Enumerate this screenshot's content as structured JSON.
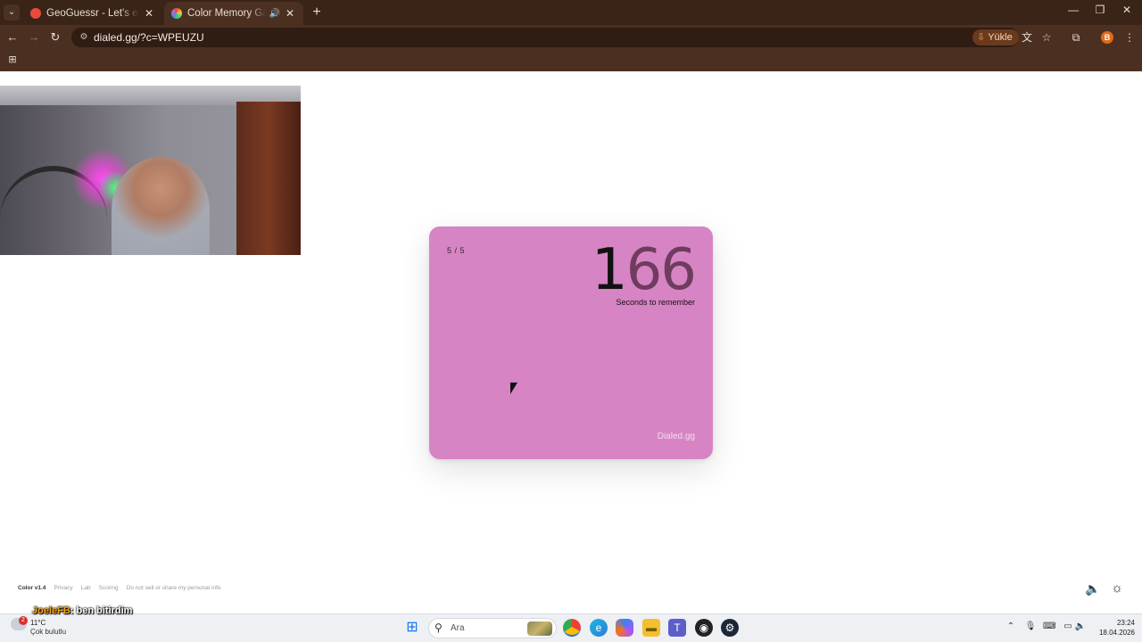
{
  "browser": {
    "tabs": [
      {
        "title": "GeoGuessr - Let's explore the world!",
        "active": false,
        "favicon_color": "#e84b3c"
      },
      {
        "title": "Color Memory Game — How good are you with colors?",
        "active": true,
        "favicon_color": "#a66ad9"
      }
    ],
    "tab_menu_icon": "chevron-down",
    "new_tab_icon": "+",
    "window_controls": [
      "minimize",
      "restore",
      "close"
    ],
    "url": "dialed.gg/?c=WPEUZU",
    "install_label": "Yükle",
    "profile_initial": "B",
    "colors": {
      "frame": "#3a2418",
      "toolbar": "#4b3022",
      "omnibox": "#2f1c12"
    }
  },
  "game": {
    "round": "5 / 5",
    "timer_first_digit": "1",
    "timer_rest_digits": "66",
    "caption": "Seconds to remember",
    "brand": "Dialed.gg",
    "card_color": "#d684c3"
  },
  "footer": {
    "version": "Color v1.4",
    "links": [
      "Privacy",
      "Lab",
      "Scoring",
      "Do not sell or share my personal info"
    ]
  },
  "chat": {
    "user": "JoeleFB",
    "message": ": ben bitirdim"
  },
  "taskbar": {
    "weather_badge": "2",
    "weather_temp": "11°C",
    "weather_desc": "Çok bulutlu",
    "search_placeholder": "Ara",
    "time": "23:24",
    "date": "18.04.2026"
  }
}
